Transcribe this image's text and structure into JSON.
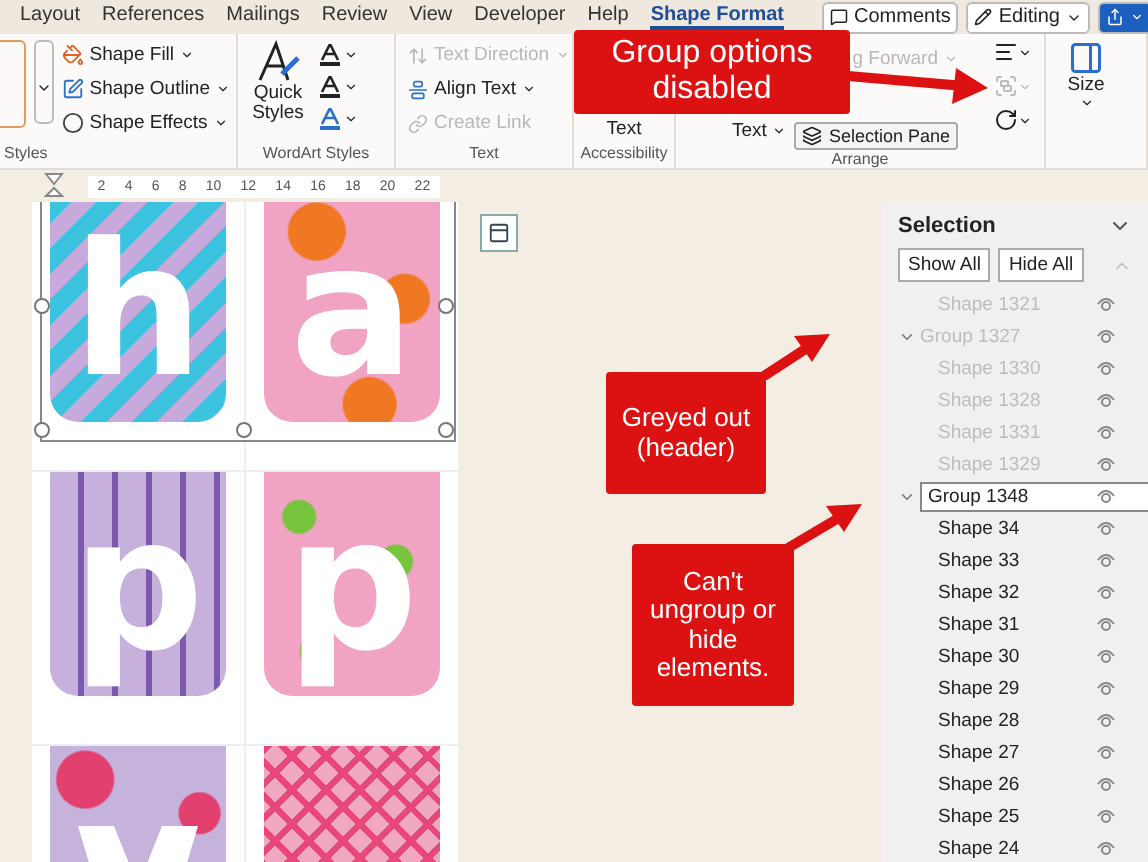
{
  "tabs": [
    {
      "label": "Layout",
      "selected": false
    },
    {
      "label": "References",
      "selected": false
    },
    {
      "label": "Mailings",
      "selected": false
    },
    {
      "label": "Review",
      "selected": false
    },
    {
      "label": "View",
      "selected": false
    },
    {
      "label": "Developer",
      "selected": false
    },
    {
      "label": "Help",
      "selected": false
    },
    {
      "label": "Shape Format",
      "selected": true
    }
  ],
  "title_actions": {
    "comments": "Comments",
    "editing": "Editing"
  },
  "ribbon": {
    "shape_styles": {
      "buttons": [
        {
          "label": "Shape Fill",
          "disabled": false
        },
        {
          "label": "Shape Outline",
          "disabled": false
        },
        {
          "label": "Shape Effects",
          "disabled": false
        }
      ],
      "group_label": "Styles"
    },
    "wordart": {
      "quick_styles": "Quick Styles",
      "group_label": "WordArt Styles"
    },
    "text": {
      "buttons": [
        {
          "label": "Text Direction",
          "disabled": true
        },
        {
          "label": "Align Text",
          "disabled": false
        },
        {
          "label": "Create Link",
          "disabled": true
        }
      ],
      "group_label": "Text"
    },
    "accessibility": {
      "button": "Text",
      "group_label": "Accessibility"
    },
    "arrange": {
      "wrap": "Text",
      "forward": "g Forward",
      "selection_pane": "Selection Pane",
      "group_disabled": true,
      "group_label": "Arrange"
    },
    "size": {
      "label": "Size"
    }
  },
  "ruler": [
    "2",
    "4",
    "6",
    "8",
    "10",
    "12",
    "14",
    "16",
    "18",
    "20",
    "22"
  ],
  "cards": [
    {
      "letter": "h",
      "kind": "diagonal"
    },
    {
      "letter": "a",
      "kind": "dots"
    },
    {
      "letter": "p",
      "kind": "vertical"
    },
    {
      "letter": "p",
      "kind": "stars"
    },
    {
      "kind": "bubbles"
    },
    {
      "kind": "lattice"
    }
  ],
  "selection_pane": {
    "title": "Selection",
    "show_all": "Show All",
    "hide_all": "Hide All",
    "items": [
      {
        "label": "Shape 1321",
        "disabled": true
      },
      {
        "label": "Group 1327",
        "disabled": true,
        "expanded": true,
        "children": [
          {
            "label": "Shape 1330",
            "disabled": true
          },
          {
            "label": "Shape 1328",
            "disabled": true
          },
          {
            "label": "Shape 1331",
            "disabled": true
          },
          {
            "label": "Shape 1329",
            "disabled": true
          }
        ]
      },
      {
        "label": "Group 1348",
        "disabled": false,
        "expanded": true,
        "editing": true,
        "children": [
          {
            "label": "Shape 34",
            "disabled": false
          },
          {
            "label": "Shape 33",
            "disabled": false
          },
          {
            "label": "Shape 32",
            "disabled": false
          },
          {
            "label": "Shape 31",
            "disabled": false
          },
          {
            "label": "Shape 30",
            "disabled": false
          },
          {
            "label": "Shape 29",
            "disabled": false
          },
          {
            "label": "Shape 28",
            "disabled": false
          },
          {
            "label": "Shape 27",
            "disabled": false
          },
          {
            "label": "Shape 26",
            "disabled": false
          },
          {
            "label": "Shape 25",
            "disabled": false
          },
          {
            "label": "Shape 24",
            "disabled": false
          }
        ]
      }
    ]
  },
  "callouts": [
    {
      "text": "Group options disabled"
    },
    {
      "text": "Greyed out (header)"
    },
    {
      "text": "Can't ungroup or hide elements."
    }
  ]
}
